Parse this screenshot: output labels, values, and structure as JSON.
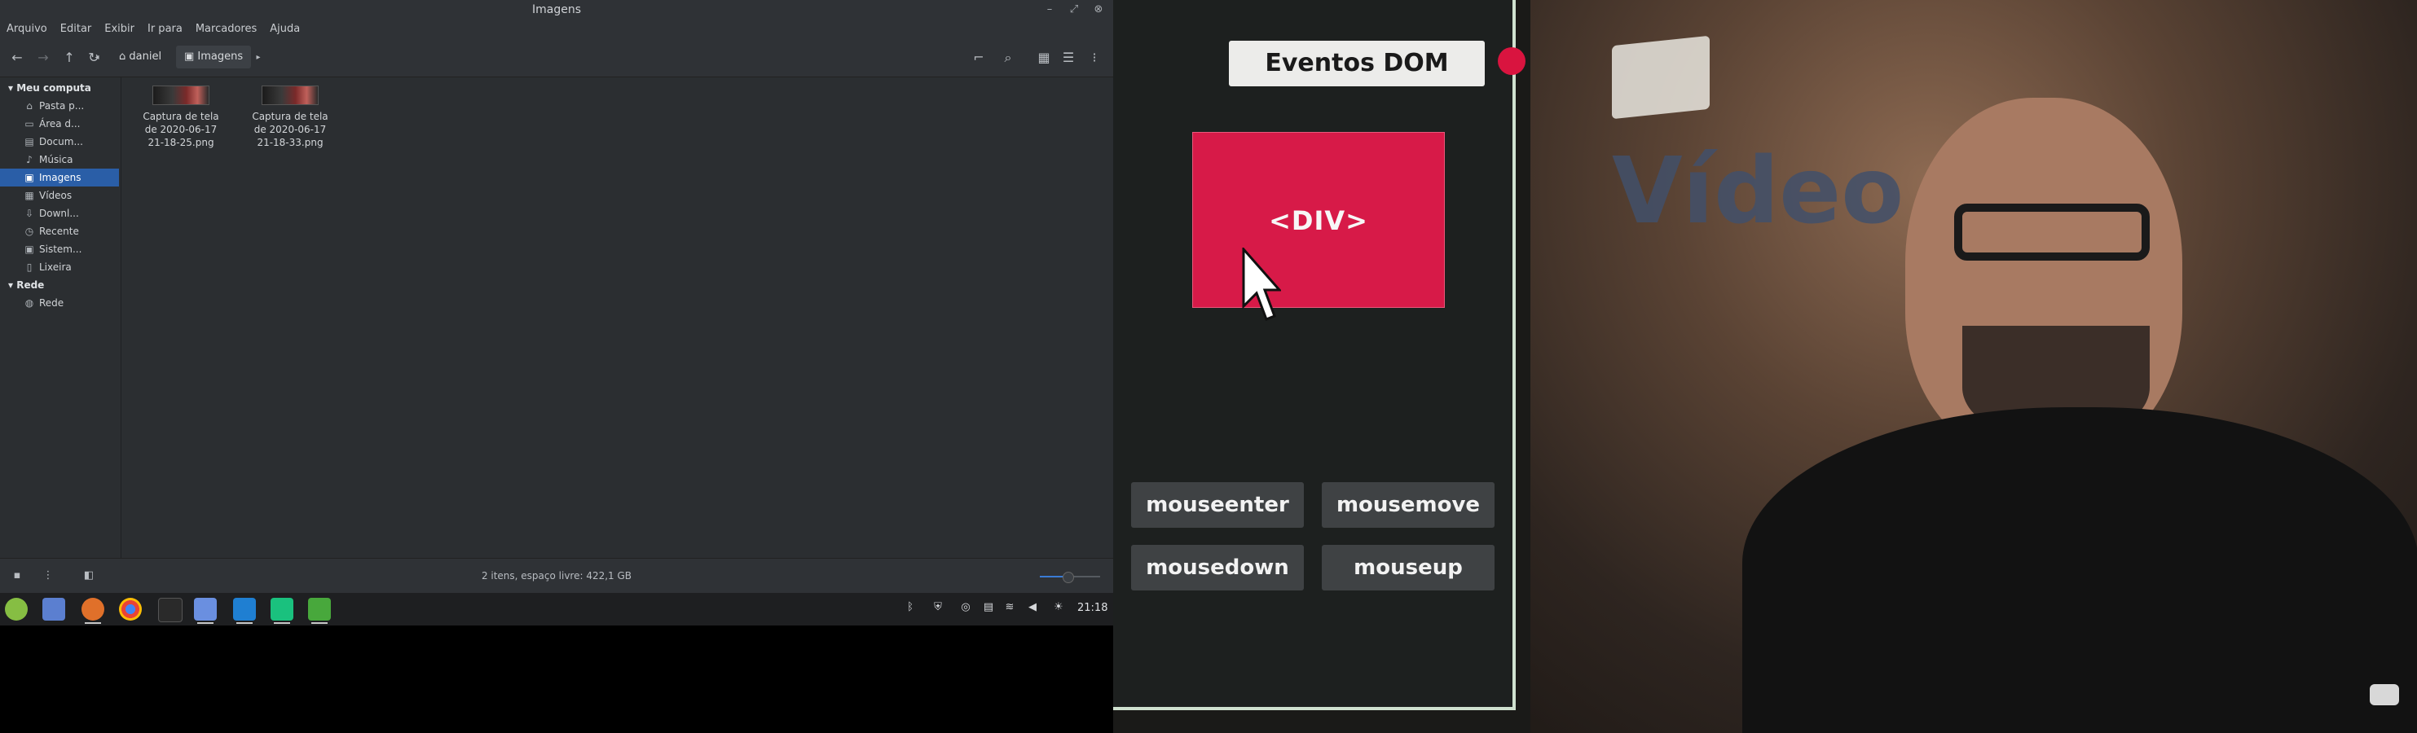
{
  "window": {
    "title": "Imagens"
  },
  "menubar": [
    "Arquivo",
    "Editar",
    "Exibir",
    "Ir para",
    "Marcadores",
    "Ajuda"
  ],
  "breadcrumb": [
    {
      "label": "daniel",
      "icon": "home-icon"
    },
    {
      "label": "Imagens",
      "icon": "camera-icon"
    }
  ],
  "sidebar": {
    "section_computer": "Meu computa",
    "items": [
      {
        "label": "Pasta p...",
        "icon": "home-icon"
      },
      {
        "label": "Área d...",
        "icon": "desktop-icon"
      },
      {
        "label": "Docum...",
        "icon": "document-icon"
      },
      {
        "label": "Música",
        "icon": "music-icon"
      },
      {
        "label": "Imagens",
        "icon": "camera-icon",
        "selected": true
      },
      {
        "label": "Vídeos",
        "icon": "film-icon"
      },
      {
        "label": "Downl...",
        "icon": "download-icon"
      },
      {
        "label": "Recente",
        "icon": "clock-icon"
      },
      {
        "label": "Sistem...",
        "icon": "drive-icon"
      },
      {
        "label": "Lixeira",
        "icon": "trash-icon"
      }
    ],
    "section_network": "Rede",
    "network_items": [
      {
        "label": "Rede",
        "icon": "globe-icon"
      }
    ]
  },
  "files": [
    {
      "line1": "Captura de tela",
      "line2": "de 2020-06-17",
      "line3": "21-18-25.png"
    },
    {
      "line1": "Captura de tela",
      "line2": "de 2020-06-17",
      "line3": "21-18-33.png"
    }
  ],
  "status": {
    "text": "2 itens, espaço livre: 422,1 GB"
  },
  "taskbar": {
    "clock": "21:18"
  },
  "video": {
    "title": "Eventos DOM",
    "box_label": "<DIV>",
    "events": [
      "mouseenter",
      "mousemove",
      "mousedown",
      "mouseup"
    ],
    "watermark": "Vídeo"
  },
  "colors": {
    "accent_selection": "#2a5ea7",
    "div_box": "#d71a48",
    "record_dot": "#d9143f"
  }
}
